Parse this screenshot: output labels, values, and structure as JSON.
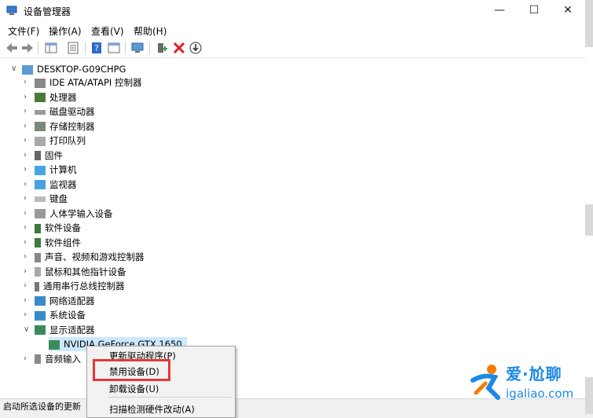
{
  "window": {
    "title": "设备管理器",
    "minimize": "—",
    "maximize": "☐",
    "close": "✕"
  },
  "menu": [
    "文件(F)",
    "操作(A)",
    "查看(V)",
    "帮助(H)"
  ],
  "tree": {
    "root": "DESKTOP-G09CHPG",
    "items": [
      "IDE ATA/ATAPI 控制器",
      "处理器",
      "磁盘驱动器",
      "存储控制器",
      "打印队列",
      "固件",
      "计算机",
      "监视器",
      "键盘",
      "人体学输入设备",
      "软件设备",
      "软件组件",
      "声音、视频和游戏控制器",
      "鼠标和其他指针设备",
      "通用串行总线控制器",
      "网络适配器",
      "系统设备",
      "显示适配器"
    ],
    "selected_child": "NVIDIA GeForce GTX 1650",
    "after_item": "音频输入"
  },
  "context_menu": {
    "items": [
      "更新驱动程序(P)",
      "禁用设备(D)",
      "卸载设备(U)",
      "扫描检测硬件改动(A)"
    ]
  },
  "status": "启动所选设备的更新",
  "watermark": {
    "cn": "爱·尬聊",
    "en": "igaliao.com"
  },
  "colors": {
    "selection": "#cce8ff",
    "highlight_box": "#e53935",
    "watermark": "#1e88e5"
  }
}
